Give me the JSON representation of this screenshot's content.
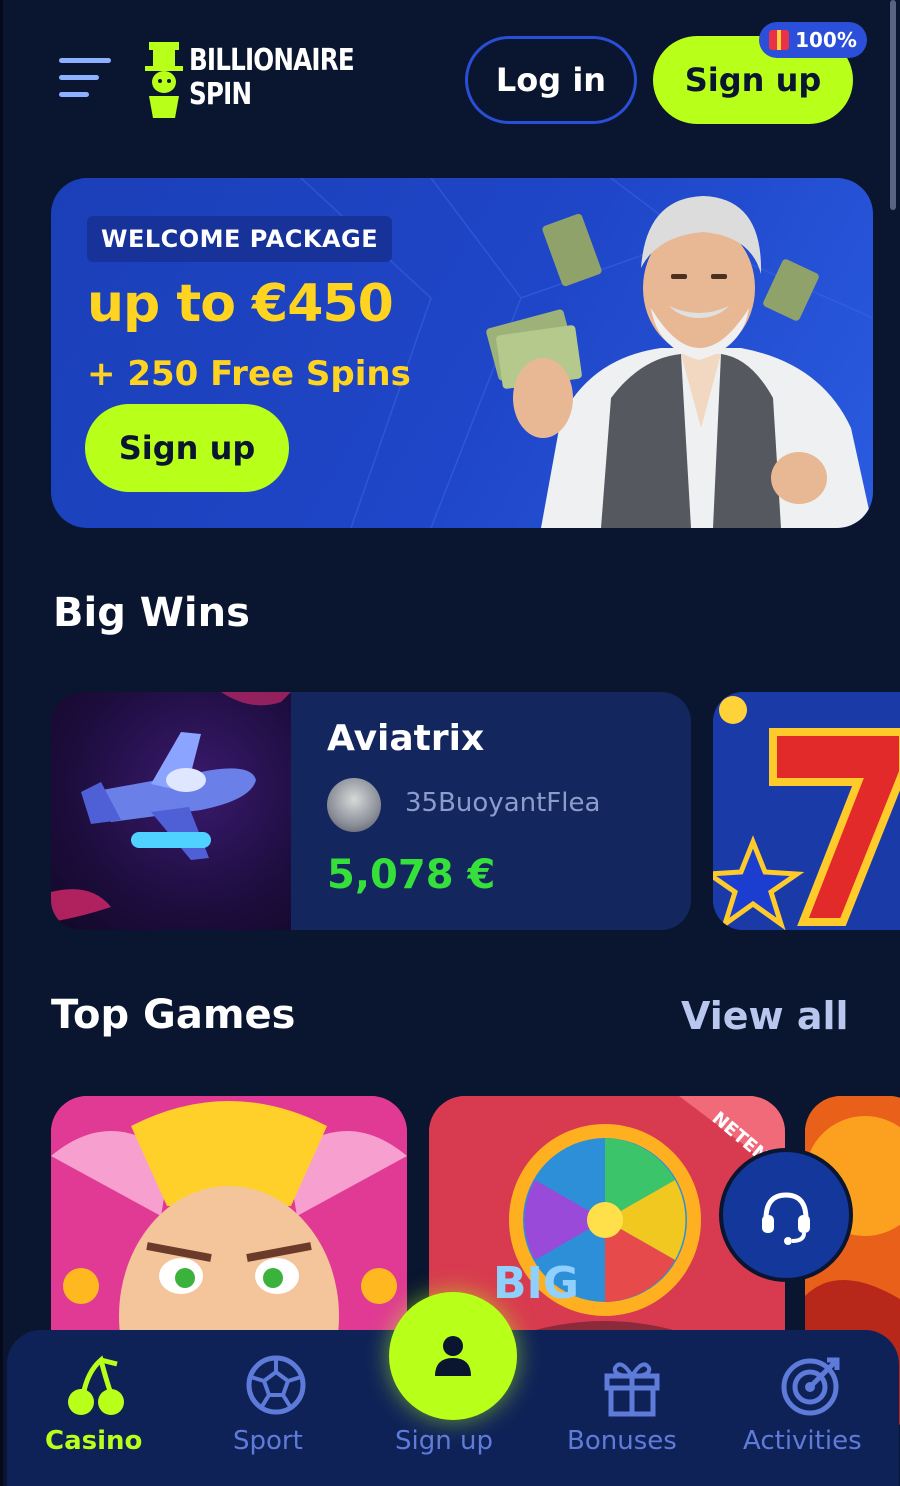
{
  "header": {
    "logo_line1": "BILLIONAIRE",
    "logo_line2": "SPIN",
    "login_label": "Log in",
    "signup_label": "Sign up",
    "signup_badge": "100%"
  },
  "banner": {
    "tag": "WELCOME PACKAGE",
    "amount": "up to €450",
    "spins": "+ 250 Free Spins",
    "cta": "Sign up"
  },
  "big_wins": {
    "title": "Big Wins",
    "items": [
      {
        "game": "Aviatrix",
        "user": "35BuoyantFlea",
        "amount": "5,078 €"
      }
    ]
  },
  "top_games": {
    "title": "Top Games",
    "view_all": "View all",
    "tile2_text": "BIG",
    "tile2_ribbon": "NETENT"
  },
  "bottom_nav": {
    "items": [
      {
        "label": "Casino",
        "icon": "cherries-icon",
        "active": true
      },
      {
        "label": "Sport",
        "icon": "soccer-ball-icon",
        "active": false
      },
      {
        "label": "Sign up",
        "icon": "user-icon",
        "active": false
      },
      {
        "label": "Bonuses",
        "icon": "gift-icon",
        "active": false
      },
      {
        "label": "Activities",
        "icon": "target-icon",
        "active": false
      }
    ]
  },
  "colors": {
    "background": "#0a1530",
    "accent_lime": "#b8ff1a",
    "accent_blue": "#2a4fd6",
    "gold": "#ffd420",
    "win_green": "#36e03a",
    "nav_inactive": "#5f7bd9"
  }
}
